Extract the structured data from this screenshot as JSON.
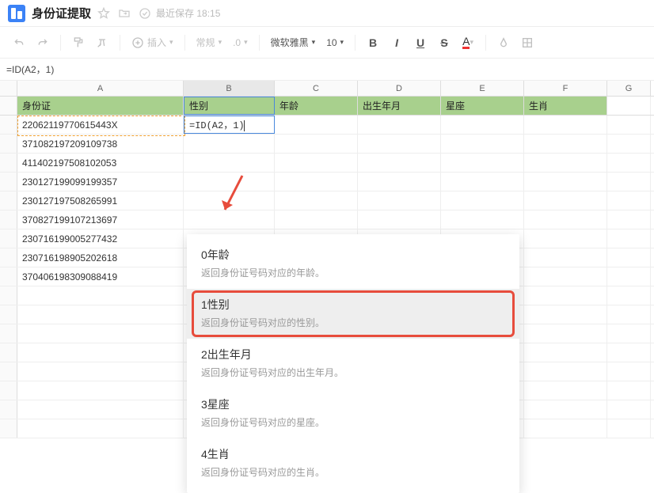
{
  "header": {
    "title": "身份证提取",
    "last_saved_prefix": "最近保存",
    "last_saved_time": "18:15"
  },
  "toolbar": {
    "insert_label": "插入",
    "format_label": "常规",
    "decimals_label": ".0",
    "font_name": "微软雅黑",
    "font_size": "10",
    "bold": "B",
    "italic": "I",
    "underline": "U",
    "strike": "S",
    "font_color": "A"
  },
  "formula_bar": {
    "value": "=ID(A2，1)"
  },
  "columns": [
    "A",
    "B",
    "C",
    "D",
    "E",
    "F",
    "G"
  ],
  "header_row": {
    "A": "身份证",
    "B": "性别",
    "C": "年龄",
    "D": "出生年月",
    "E": "星座",
    "F": "生肖"
  },
  "editing_cell": {
    "value": "=ID(A2，1)"
  },
  "data_rows": [
    "22062119770615443X",
    "371082197209109738",
    "411402197508102053",
    "230127199099199357",
    "230127197508265991",
    "370827199107213697",
    "230716199005277432",
    "230716198905202618",
    "370406198309088419"
  ],
  "dropdown": {
    "items": [
      {
        "title": "0年龄",
        "desc": "返回身份证号码对应的年龄。"
      },
      {
        "title": "1性别",
        "desc": "返回身份证号码对应的性别。"
      },
      {
        "title": "2出生年月",
        "desc": "返回身份证号码对应的出生年月。"
      },
      {
        "title": "3星座",
        "desc": "返回身份证号码对应的星座。"
      },
      {
        "title": "4生肖",
        "desc": "返回身份证号码对应的生肖。"
      }
    ],
    "highlighted_index": 1
  }
}
